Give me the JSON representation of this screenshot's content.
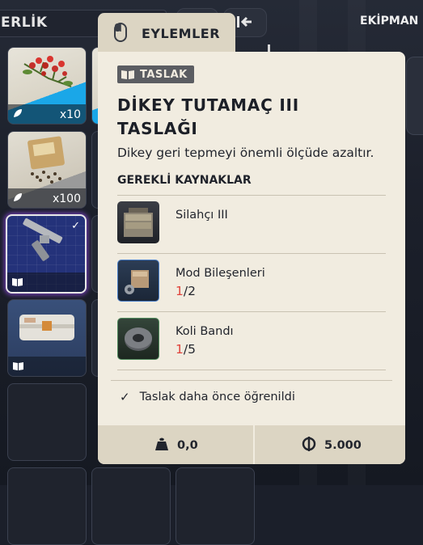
{
  "inventory": {
    "title_partial": "ERLİK",
    "slots": [
      {
        "name": "slot-plant",
        "count": "x10"
      },
      {
        "name": "slot-seeds",
        "count": "x100"
      },
      {
        "name": "slot-blueprint-selected",
        "count": ""
      },
      {
        "name": "slot-blueprint-crate",
        "count": ""
      }
    ]
  },
  "equipment": {
    "title": "EKİPMAN"
  },
  "tooltip": {
    "tab_label": "EYLEMLER",
    "badge": "TASLAK",
    "title": "DİKEY TUTAMAÇ III TASLAĞI",
    "description": "Dikey geri tepmeyi önemli ölçüde azaltır.",
    "requirements_header": "GEREKLİ KAYNAKLAR",
    "requirements": [
      {
        "name": "Silahçı III",
        "have": "",
        "need": ""
      },
      {
        "name": "Mod Bileşenleri",
        "have": "1",
        "need": "/2"
      },
      {
        "name": "Koli Bandı",
        "have": "1",
        "need": "/5"
      }
    ],
    "learned_text": "Taslak daha önce öğrenildi",
    "weight": "0,0",
    "price": "5.000"
  },
  "colors": {
    "card_bg": "#f1ece0",
    "tab_bg": "#dcd5c3",
    "shortage_red": "#e0453d",
    "badge_bg": "#5b5d62"
  }
}
